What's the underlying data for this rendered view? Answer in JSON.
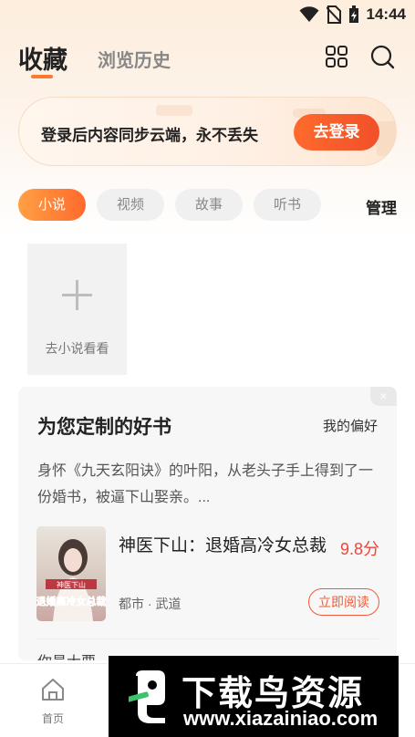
{
  "status_bar": {
    "time": "14:44",
    "icons": [
      "wifi-icon",
      "no-sim-icon",
      "battery-charging-icon"
    ]
  },
  "header": {
    "active_tab": "收藏",
    "other_tab": "浏览历史",
    "icons": [
      "grid-icon",
      "search-icon"
    ],
    "accent_color": "#ff7a2e"
  },
  "banner": {
    "text": "登录后内容同步云端，永不丢失",
    "button_label": "去登录"
  },
  "categories": [
    {
      "label": "小说",
      "active": true
    },
    {
      "label": "视频",
      "active": false
    },
    {
      "label": "故事",
      "active": false
    },
    {
      "label": "听书",
      "active": false
    }
  ],
  "manage_label": "管理",
  "add_tile": {
    "label": "去小说看看"
  },
  "recommend": {
    "title": "为您定制的好书",
    "preference_link": "我的偏好",
    "close_symbol": "×",
    "description": "身怀《九天玄阳诀》的叶阳，从老头子手上得到了一份婚书，被逼下山娶亲。...",
    "book": {
      "title": "神医下山：退婚高冷女总裁",
      "score": "9.8分",
      "tags": "都市 · 武道",
      "read_button": "立即阅读",
      "cover_text": "退婚高冷女总裁",
      "cover_top_text": "神医下山"
    },
    "next_partial": "你最大要"
  },
  "tabbar": {
    "home_label": "首页"
  },
  "watermark": {
    "title": "下载鸟资源",
    "url": "www.xiazainiao.com"
  }
}
